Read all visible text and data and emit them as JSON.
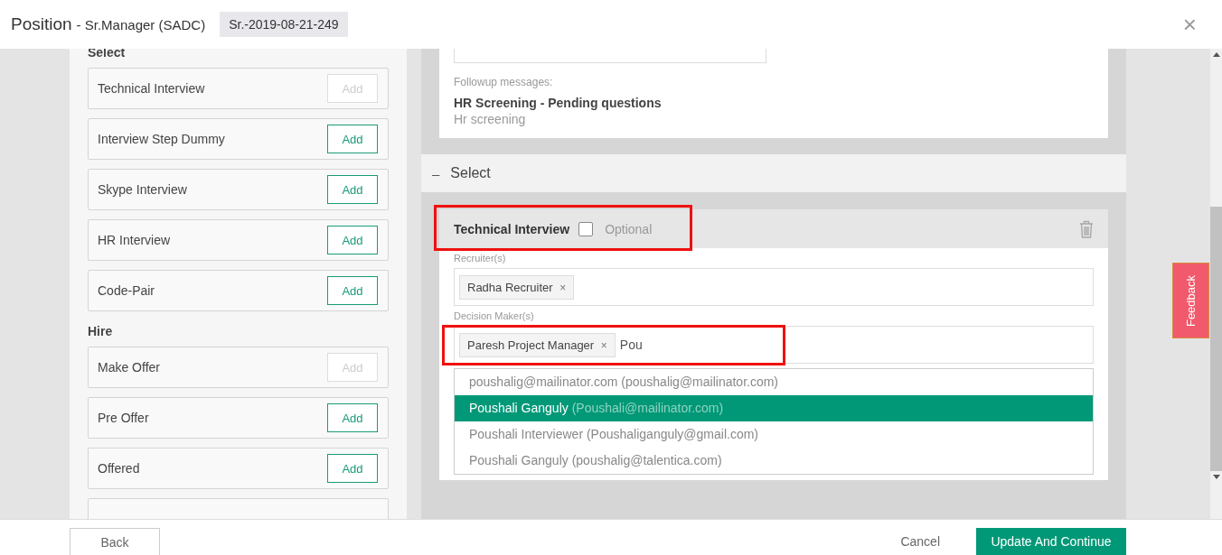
{
  "header": {
    "title": "Position",
    "subtitle": "- Sr.Manager (SADC)",
    "code": "Sr.-2019-08-21-249",
    "close": "×"
  },
  "stages": [
    {
      "heading": "Select",
      "items": [
        {
          "label": "Technical Interview",
          "button": "Add",
          "disabled": true
        },
        {
          "label": "Interview Step Dummy",
          "button": "Add",
          "disabled": false
        },
        {
          "label": "Skype Interview",
          "button": "Add",
          "disabled": false
        },
        {
          "label": "HR Interview",
          "button": "Add",
          "disabled": false
        },
        {
          "label": "Code-Pair",
          "button": "Add",
          "disabled": false
        }
      ]
    },
    {
      "heading": "Hire",
      "items": [
        {
          "label": "Make Offer",
          "button": "Add",
          "disabled": true
        },
        {
          "label": "Pre Offer",
          "button": "Add",
          "disabled": false
        },
        {
          "label": "Offered",
          "button": "Add",
          "disabled": false
        }
      ]
    }
  ],
  "form_card": {
    "followup_label": "Followup messages:",
    "followup_title": "HR Screening - Pending questions",
    "followup_sub": "Hr screening"
  },
  "section": {
    "toggle": "–",
    "title": "Select"
  },
  "step": {
    "title": "Technical Interview",
    "optional_checked": false,
    "optional_label": "Optional",
    "recruiters_label": "Recruiter(s)",
    "recruiters": [
      {
        "name": "Radha Recruiter",
        "remove": "×"
      }
    ],
    "decision_label": "Decision Maker(s)",
    "decision_makers": [
      {
        "name": "Paresh Project Manager",
        "remove": "×"
      }
    ],
    "decision_query": "Pou",
    "suggestions": [
      {
        "name": "poushalig@mailinator.com",
        "email": "(poushalig@mailinator.com)",
        "selected": false
      },
      {
        "name": "Poushali Ganguly",
        "email": "(Poushali@mailinator.com)",
        "selected": true
      },
      {
        "name": "Poushali Interviewer",
        "email": "(Poushaliganguly@gmail.com)",
        "selected": false
      },
      {
        "name": "Poushali Ganguly",
        "email": "(poushalig@talentica.com)",
        "selected": false
      }
    ]
  },
  "feedback": "Feedback",
  "footer": {
    "back": "Back",
    "cancel": "Cancel",
    "primary": "Update And Continue"
  }
}
